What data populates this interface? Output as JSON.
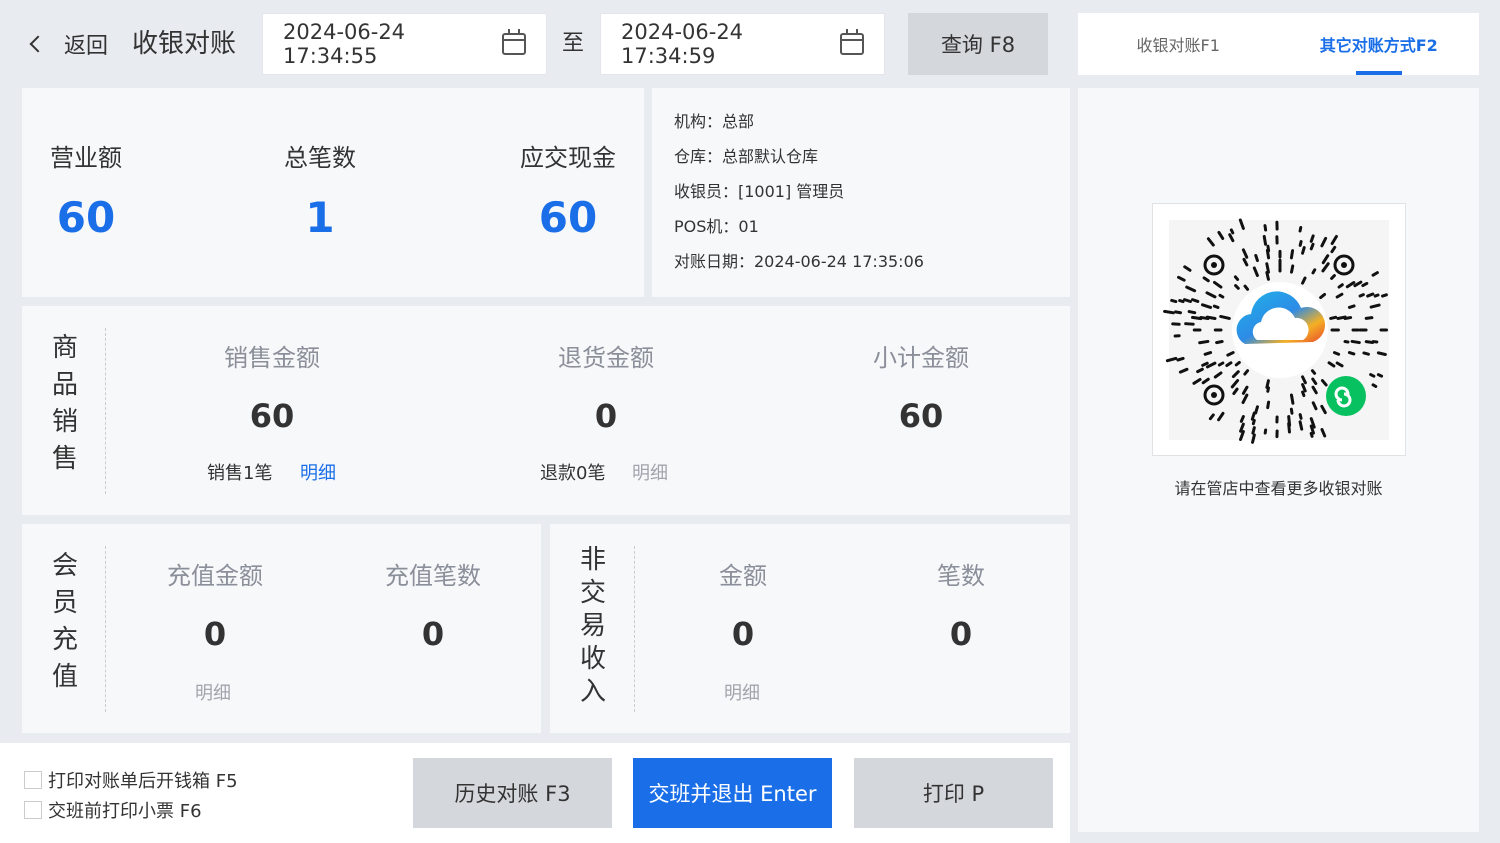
{
  "header": {
    "back_label": "返回",
    "title": "收银对账",
    "start_date": "2024-06-24 17:34:55",
    "to_label": "至",
    "end_date": "2024-06-24 17:34:59",
    "query_label": "查询 F8"
  },
  "tabs": [
    {
      "label": "收银对账F1",
      "active": false
    },
    {
      "label": "其它对账方式F2",
      "active": true
    }
  ],
  "summary": {
    "revenue_label": "营业额",
    "revenue_value": "60",
    "count_label": "总笔数",
    "count_value": "1",
    "cash_label": "应交现金",
    "cash_value": "60"
  },
  "info": {
    "org": "机构：总部",
    "warehouse": "仓库：总部默认仓库",
    "cashier": "收银员：[1001] 管理员",
    "pos": "POS机：01",
    "recon_date": "对账日期：2024-06-24 17:35:06"
  },
  "goods_sales": {
    "label_chars": [
      "商",
      "品",
      "销",
      "售"
    ],
    "sales_label": "销售金额",
    "sales_value": "60",
    "refund_label": "退货金额",
    "refund_value": "0",
    "subtotal_label": "小计金额",
    "subtotal_value": "60",
    "sales_count": "销售1笔",
    "sales_detail": "明细",
    "refund_count": "退款0笔",
    "refund_detail": "明细"
  },
  "member_recharge": {
    "label_chars": [
      "会",
      "员",
      "充",
      "值"
    ],
    "amount_label": "充值金额",
    "amount_value": "0",
    "count_label": "充值笔数",
    "count_value": "0",
    "detail": "明细"
  },
  "non_trade": {
    "label_chars": [
      "非",
      "交",
      "易",
      "收",
      "入"
    ],
    "amount_label": "金额",
    "amount_value": "0",
    "count_label": "笔数",
    "count_value": "0",
    "detail": "明细"
  },
  "qr": {
    "caption": "请在管店中查看更多收银对账"
  },
  "bottom": {
    "opt_open_drawer": "打印对账单后开钱箱 F5",
    "opt_print_receipt": "交班前打印小票 F6",
    "history_label": "历史对账 F3",
    "shift_label": "交班并退出 Enter",
    "print_label": "打印 P"
  },
  "colors": {
    "accent": "#1a6fe8",
    "page_bg": "#e8ebf0",
    "muted": "#8a8f99"
  }
}
